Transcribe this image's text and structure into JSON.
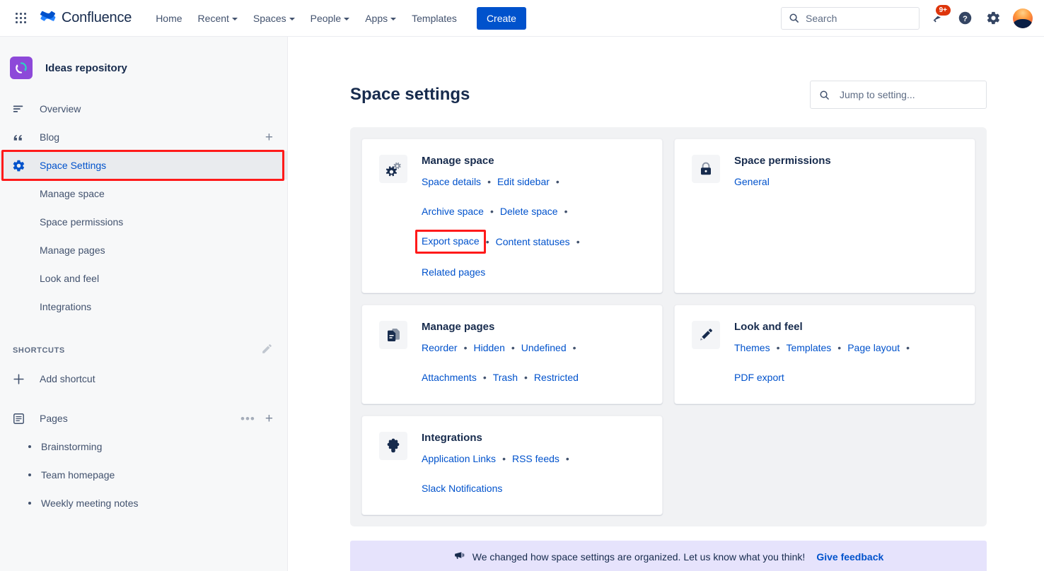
{
  "topnav": {
    "app_switcher_icon": "grid-apps-icon",
    "brand": "Confluence",
    "items": [
      {
        "label": "Home",
        "caret": false
      },
      {
        "label": "Recent",
        "caret": true
      },
      {
        "label": "Spaces",
        "caret": true
      },
      {
        "label": "People",
        "caret": true
      },
      {
        "label": "Apps",
        "caret": true
      },
      {
        "label": "Templates",
        "caret": false
      }
    ],
    "create_label": "Create",
    "search": {
      "placeholder": "Search",
      "value": "",
      "icon": "search-icon"
    },
    "notifications": {
      "icon": "bell-icon",
      "badge": "9+"
    },
    "help": {
      "icon": "help-icon"
    },
    "settings": {
      "icon": "gear-icon"
    },
    "avatar": {
      "icon": "user-avatar"
    }
  },
  "sidebar": {
    "space_name": "Ideas repository",
    "space_avatar_icon": "refresh-circle-icon",
    "nav": [
      {
        "label": "Overview",
        "icon": "overview-lines-icon",
        "selected": false,
        "action": null
      },
      {
        "label": "Blog",
        "icon": "quote-icon",
        "selected": false,
        "action": "add-icon"
      },
      {
        "label": "Space Settings",
        "icon": "gear-icon",
        "selected": true,
        "action": null
      }
    ],
    "sub_items": [
      {
        "label": "Manage space"
      },
      {
        "label": "Space permissions"
      },
      {
        "label": "Manage pages"
      },
      {
        "label": "Look and feel"
      },
      {
        "label": "Integrations"
      }
    ],
    "shortcuts": {
      "title": "SHORTCUTS",
      "edit_icon": "pencil-icon"
    },
    "add_shortcut": {
      "label": "Add shortcut",
      "icon": "plus-icon"
    },
    "pages": {
      "label": "Pages",
      "icon": "pages-icon",
      "more_icon": "more-dots-icon",
      "add_icon": "plus-icon"
    },
    "page_items": [
      {
        "label": "Brainstorming"
      },
      {
        "label": "Team homepage"
      },
      {
        "label": "Weekly meeting notes"
      }
    ]
  },
  "main": {
    "page_title": "Space settings",
    "jump_search": {
      "placeholder": "Jump to setting...",
      "value": "",
      "icon": "search-icon"
    },
    "cards": [
      {
        "title": "Manage space",
        "icon": "cogs-icon",
        "links": [
          "Space details",
          "Edit sidebar",
          "Archive space",
          "Delete space",
          "Export space",
          "Content statuses",
          "Related pages"
        ],
        "line_breaks": [
          2,
          4,
          6
        ],
        "highlighted_link": "Export space"
      },
      {
        "title": "Space permissions",
        "icon": "lock-icon",
        "links": [
          "General"
        ],
        "line_breaks": [],
        "highlighted_link": null
      },
      {
        "title": "Manage pages",
        "icon": "pages-stack-icon",
        "links": [
          "Reorder",
          "Hidden",
          "Undefined",
          "Attachments",
          "Trash",
          "Restricted"
        ],
        "line_breaks": [
          3
        ],
        "highlighted_link": null
      },
      {
        "title": "Look and feel",
        "icon": "pencil-icon",
        "links": [
          "Themes",
          "Templates",
          "Page layout",
          "PDF export"
        ],
        "line_breaks": [
          3
        ],
        "highlighted_link": null
      },
      {
        "title": "Integrations",
        "icon": "puzzle-icon",
        "links": [
          "Application Links",
          "RSS feeds",
          "Slack Notifications"
        ],
        "line_breaks": [
          2
        ],
        "highlighted_link": null
      }
    ],
    "feedback": {
      "icon": "megaphone-icon",
      "text": "We changed how space settings are organized. Let us know what you think!",
      "link": "Give feedback"
    }
  },
  "colors": {
    "brand_blue": "#0052CC",
    "link_blue": "#0052CC",
    "highlight_red": "#FF1A1A",
    "panel_gray": "#F1F2F4",
    "sidebar_gray": "#F7F8F9",
    "selected_row": "#E9EBEE",
    "badge_red": "#DE350B",
    "feedback_lavender": "#E6E3FC",
    "space_avatar_purple": "#8D49D9"
  }
}
